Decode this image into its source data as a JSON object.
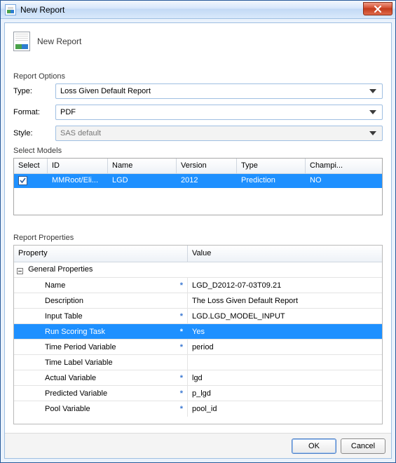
{
  "window": {
    "title": "New Report"
  },
  "banner": {
    "title": "New Report"
  },
  "options": {
    "section_label": "Report Options",
    "type_label": "Type:",
    "type_value": "Loss Given Default Report",
    "format_label": "Format:",
    "format_value": "PDF",
    "style_label": "Style:",
    "style_value": "SAS default"
  },
  "models": {
    "section_label": "Select Models",
    "columns": {
      "select": "Select",
      "id": "ID",
      "name": "Name",
      "version": "Version",
      "type": "Type",
      "champion": "Champi..."
    },
    "rows": [
      {
        "checked": true,
        "id": "MMRoot/Eli...",
        "name": "LGD",
        "version": "2012",
        "type": "Prediction",
        "champion": "NO"
      }
    ]
  },
  "properties": {
    "section_label": "Report Properties",
    "col_property": "Property",
    "col_value": "Value",
    "group_general": "General Properties",
    "rows": [
      {
        "name": "Name",
        "required": true,
        "value": "LGD_D2012-07-03T09.21",
        "selected": false
      },
      {
        "name": "Description",
        "required": false,
        "value": "The Loss Given Default Report",
        "selected": false
      },
      {
        "name": "Input Table",
        "required": true,
        "value": "LGD.LGD_MODEL_INPUT",
        "selected": false
      },
      {
        "name": "Run Scoring Task",
        "required": true,
        "value": "Yes",
        "selected": true
      },
      {
        "name": "Time Period Variable",
        "required": true,
        "value": "period",
        "selected": false
      },
      {
        "name": "Time Label Variable",
        "required": false,
        "value": "",
        "selected": false
      },
      {
        "name": "Actual Variable",
        "required": true,
        "value": "lgd",
        "selected": false
      },
      {
        "name": "Predicted Variable",
        "required": true,
        "value": "p_lgd",
        "selected": false
      },
      {
        "name": "Pool Variable",
        "required": true,
        "value": "pool_id",
        "selected": false
      }
    ]
  },
  "buttons": {
    "ok": "OK",
    "cancel": "Cancel"
  },
  "asterisk": "*"
}
